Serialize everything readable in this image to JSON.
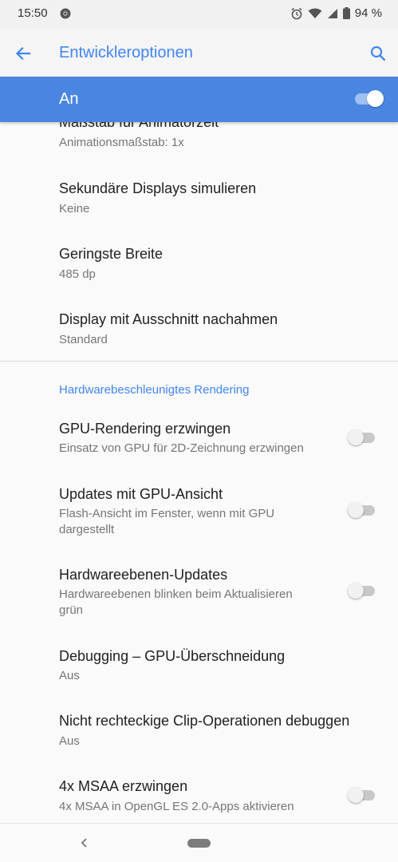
{
  "status_bar": {
    "time": "15:50",
    "battery": "94 %",
    "icons": [
      "chrome-icon",
      "alarm-icon",
      "wifi-icon",
      "signal-icon",
      "battery-icon"
    ]
  },
  "toolbar": {
    "title": "Entwickleroptionen",
    "back_icon": "arrow-back-icon",
    "search_icon": "search-icon"
  },
  "master": {
    "label": "An",
    "enabled": true
  },
  "items": [
    {
      "title": "Maßstab für Animatorzeit",
      "summary": "Animationsmaßstab: 1x"
    },
    {
      "title": "Sekundäre Displays simulieren",
      "summary": "Keine"
    },
    {
      "title": "Geringste Breite",
      "summary": "485 dp"
    },
    {
      "title": "Display mit Ausschnitt nachahmen",
      "summary": "Standard"
    }
  ],
  "section": {
    "header": "Hardwarebeschleunigtes Rendering",
    "items": [
      {
        "title": "GPU-Rendering erzwingen",
        "summary": "Einsatz von GPU für 2D-Zeichnung erzwingen",
        "toggle": false
      },
      {
        "title": "Updates mit GPU-Ansicht",
        "summary": "Flash-Ansicht im Fenster, wenn mit GPU dargestellt",
        "toggle": false
      },
      {
        "title": "Hardwareebenen-Updates",
        "summary": "Hardwareebenen blinken beim Aktualisieren grün",
        "toggle": false
      },
      {
        "title": "Debugging – GPU-Überschneidung",
        "summary": "Aus"
      },
      {
        "title": "Nicht rechteckige Clip-Operationen debuggen",
        "summary": "Aus"
      },
      {
        "title": "4x MSAA erzwingen",
        "summary": "4x MSAA in OpenGL ES 2.0-Apps aktivieren",
        "toggle": false
      }
    ]
  },
  "colors": {
    "accent": "#4285f4",
    "master_bar": "#4a86e1"
  }
}
